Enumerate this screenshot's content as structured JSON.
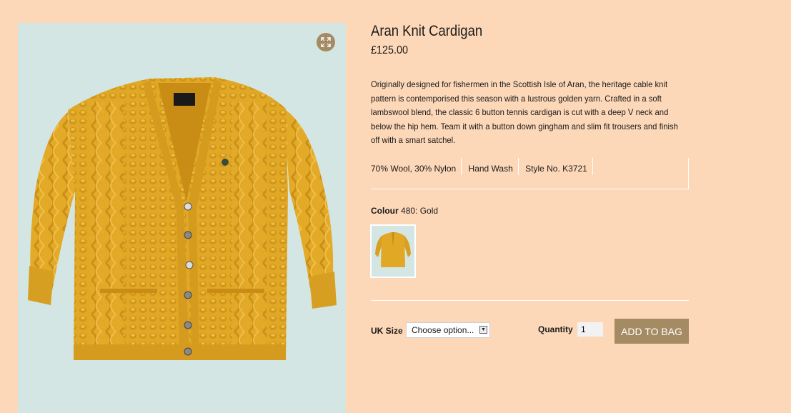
{
  "product": {
    "title": "Aran Knit Cardigan",
    "price": "£125.00",
    "description": "Originally designed for fishermen in the Scottish Isle of Aran, the heritage cable knit pattern is contemporised this season with a lustrous golden yarn. Crafted in a soft lambswool blend, the classic 6 button tennis cardigan is cut with a deep V neck and below the hip hem. Team it with a button down gingham and slim fit trousers and finish off with a smart satchel.",
    "attributes": [
      "70% Wool, 30% Nylon",
      "Hand Wash",
      "Style No. K3721"
    ]
  },
  "colour": {
    "label": "Colour",
    "value": "480: Gold"
  },
  "form": {
    "size_label": "UK Size",
    "size_selected": "Choose option...",
    "quantity_label": "Quantity",
    "quantity_value": "1",
    "add_button": "ADD TO BAG"
  },
  "colors": {
    "page_bg": "#fdd8b8",
    "image_bg": "#d3e6e3",
    "accent": "#a48b64",
    "cardigan": "#e4ac2a"
  },
  "icons": {
    "expand": "expand-icon",
    "dropdown": "chevron-down-icon"
  }
}
